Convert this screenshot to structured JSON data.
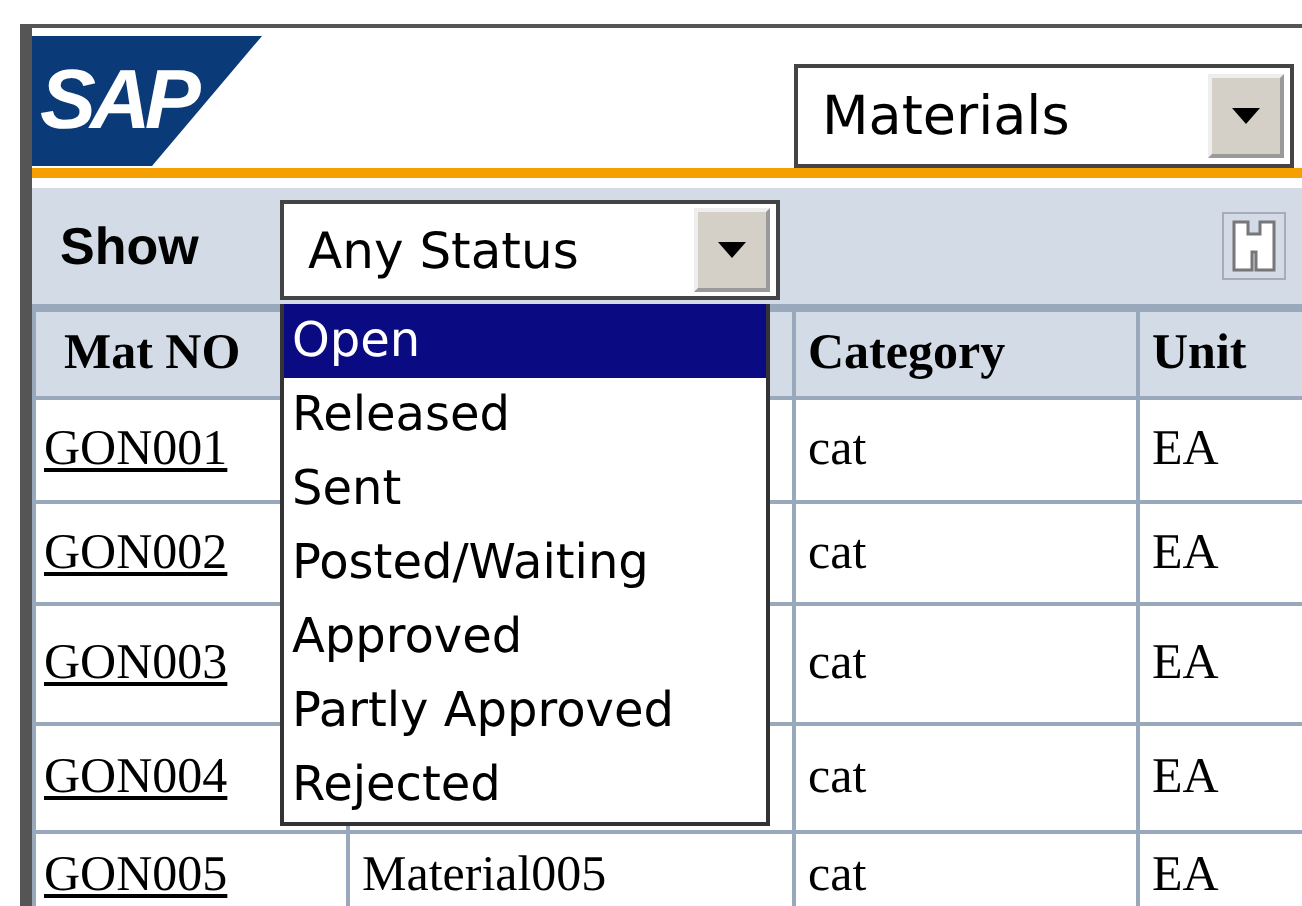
{
  "logo": {
    "text": "SAP"
  },
  "object_select": {
    "value": "Materials"
  },
  "filter": {
    "label": "Show",
    "value": "Any Status",
    "expanded": true,
    "options": [
      {
        "label": "Open",
        "selected": true
      },
      {
        "label": "Released",
        "selected": false
      },
      {
        "label": "Sent",
        "selected": false
      },
      {
        "label": "Posted/Waiting",
        "selected": false
      },
      {
        "label": "Approved",
        "selected": false
      },
      {
        "label": "Partly Approved",
        "selected": false
      },
      {
        "label": "Rejected",
        "selected": false
      }
    ]
  },
  "table": {
    "columns": [
      "Mat NO",
      "Category",
      "Unit"
    ],
    "rows": [
      {
        "mat_no": "GON001",
        "category": "cat",
        "unit": "EA"
      },
      {
        "mat_no": "GON002",
        "category": "cat",
        "unit": "EA"
      },
      {
        "mat_no": "GON003",
        "category": "cat",
        "unit": "EA"
      },
      {
        "mat_no": "GON004",
        "category": "cat",
        "unit": "EA"
      },
      {
        "mat_no": "GON005",
        "material": "Material005",
        "category": "cat",
        "unit": "EA"
      }
    ]
  }
}
